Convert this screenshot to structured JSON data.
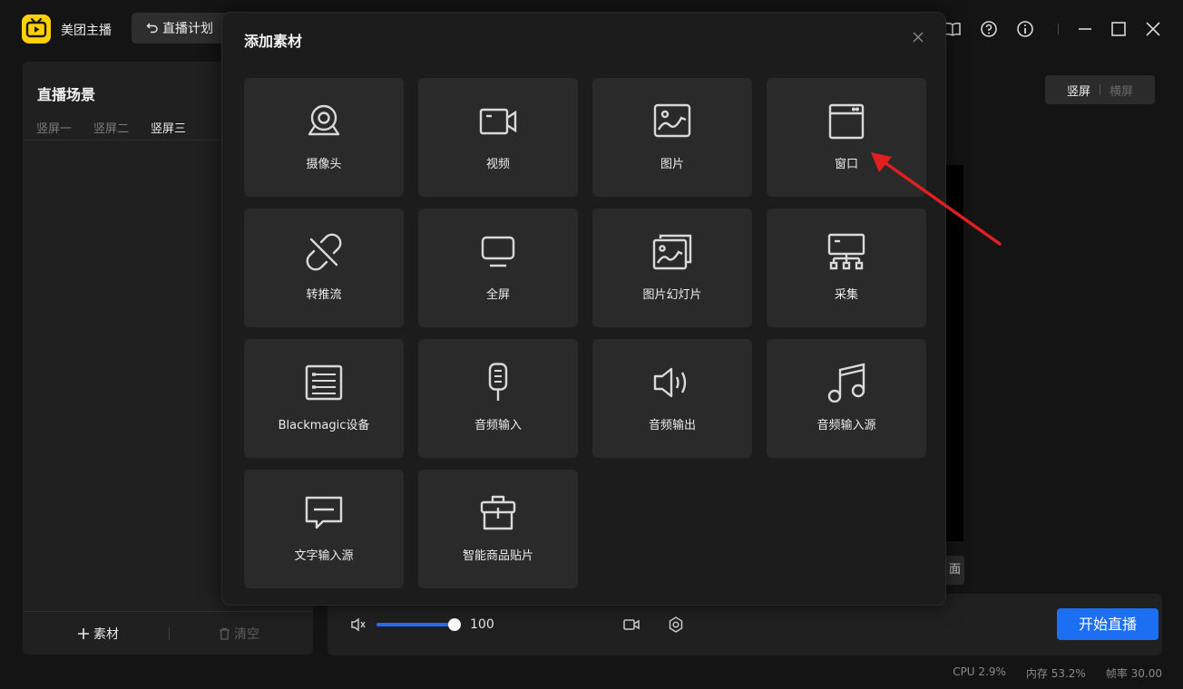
{
  "app": {
    "name": "美团主播",
    "plan_button": "直播计划"
  },
  "left_panel": {
    "title": "直播场景",
    "tabs": [
      "竖屏一",
      "竖屏二",
      "竖屏三"
    ],
    "add_label": "素材",
    "clear_label": "清空"
  },
  "orientation": {
    "active": "竖屏",
    "inactive": "横屏"
  },
  "preview": {
    "partial_button": "面"
  },
  "controls": {
    "volume": 100,
    "volume_label": "100",
    "start_label": "开始直播"
  },
  "status": {
    "cpu": "CPU  2.9%",
    "memory": "内存  53.2%",
    "fps": "帧率  30.00"
  },
  "modal": {
    "title": "添加素材",
    "tiles": [
      {
        "label": "摄像头",
        "icon": "webcam-icon"
      },
      {
        "label": "视频",
        "icon": "video-icon"
      },
      {
        "label": "图片",
        "icon": "image-icon"
      },
      {
        "label": "窗口",
        "icon": "window-icon"
      },
      {
        "label": "转推流",
        "icon": "unlink-icon"
      },
      {
        "label": "全屏",
        "icon": "monitor-icon"
      },
      {
        "label": "图片幻灯片",
        "icon": "slideshow-icon"
      },
      {
        "label": "采集",
        "icon": "capture-icon"
      },
      {
        "label": "Blackmagic设备",
        "icon": "device-icon"
      },
      {
        "label": "音频输入",
        "icon": "microphone-icon"
      },
      {
        "label": "音频输出",
        "icon": "speaker-icon"
      },
      {
        "label": "音频输入源",
        "icon": "music-icon"
      },
      {
        "label": "文字输入源",
        "icon": "text-bubble-icon"
      },
      {
        "label": "智能商品贴片",
        "icon": "shopping-bag-icon"
      }
    ]
  },
  "colors": {
    "accent": "#1c6ef2",
    "logo": "#ffd100",
    "annotation": "#e02020"
  }
}
